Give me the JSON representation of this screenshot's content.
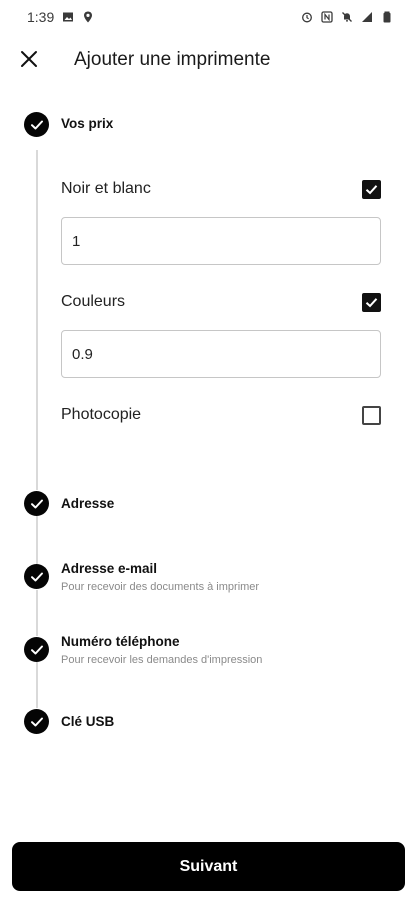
{
  "status_bar": {
    "time": "1:39",
    "left_icons": [
      "image-icon",
      "location-pin-icon"
    ],
    "right_icons": [
      "alarm-icon",
      "nfc-icon",
      "notifications-off-icon",
      "signal-icon",
      "battery-icon"
    ]
  },
  "app_bar": {
    "close_icon": "close-icon",
    "title": "Ajouter une imprimente"
  },
  "steps": [
    {
      "title": "Vos prix",
      "subtitle": "",
      "done": true
    },
    {
      "title": "Adresse",
      "subtitle": "",
      "done": true
    },
    {
      "title": "Adresse e-mail",
      "subtitle": "Pour recevoir des documents à imprimer",
      "done": true
    },
    {
      "title": "Numéro téléphone",
      "subtitle": "Pour recevoir les demandes d'impression",
      "done": true
    },
    {
      "title": "Clé USB",
      "subtitle": "",
      "done": true
    }
  ],
  "prices": {
    "bw": {
      "label": "Noir et blanc",
      "checked": true,
      "value": "1"
    },
    "color": {
      "label": "Couleurs",
      "checked": true,
      "value": "0.9"
    },
    "photocopy": {
      "label": "Photocopie",
      "checked": false
    }
  },
  "next_button": {
    "label": "Suivant"
  },
  "colors": {
    "accent": "#000000",
    "text": "#111111",
    "muted": "#8a8a8a",
    "line": "#d9d9d9"
  }
}
